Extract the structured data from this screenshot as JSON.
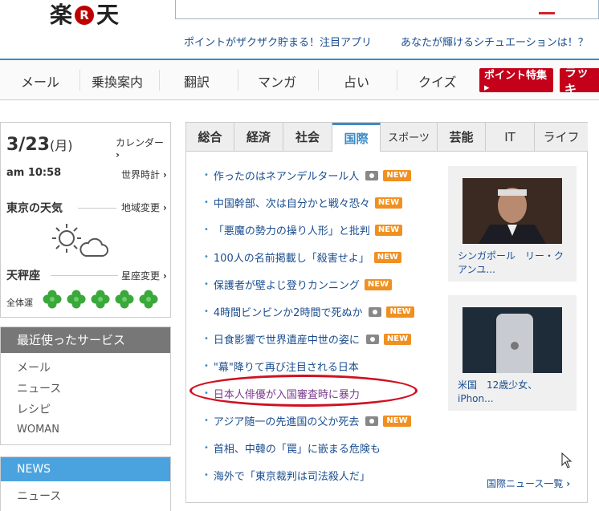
{
  "header": {
    "logo_left": "楽",
    "logo_r": "R",
    "logo_right": "天",
    "promo_1": "ポイントがザクザク貯まる！注目アプリ",
    "promo_2": "あなたが輝けるシチュエーションは！？"
  },
  "nav": {
    "items": [
      "メール",
      "乗換案内",
      "翻訳",
      "マンガ",
      "占い",
      "クイズ"
    ],
    "button_1": "ポイント特集 ▸",
    "button_2": "ラッキ"
  },
  "datebox": {
    "date": "3/23",
    "weekday": "(月)",
    "calendar": "カレンダー",
    "time": "am 10:58",
    "world_clock": "世界時計",
    "weather_title": "東京の天気",
    "region_change": "地域変更",
    "horoscope_title": "天秤座",
    "sign_change": "星座変更",
    "fortune_label": "全体運",
    "fortune_level": 5
  },
  "services": {
    "title": "最近使ったサービス",
    "items": [
      "メール",
      "ニュース",
      "レシピ",
      "WOMAN"
    ]
  },
  "news_sidebar": {
    "title": "NEWS",
    "item": "ニュース"
  },
  "main": {
    "tabs": [
      "総合",
      "経済",
      "社会",
      "国際",
      "スポーツ",
      "芸能",
      "IT",
      "ライフ"
    ],
    "active_tab": "国際",
    "headlines": [
      {
        "text": "作ったのはネアンデルタール人",
        "camera": true,
        "new": true
      },
      {
        "text": "中国幹部、次は自分かと戦々恐々",
        "camera": false,
        "new": true
      },
      {
        "text": "「悪魔の勢力の操り人形」と批判",
        "camera": false,
        "new": true
      },
      {
        "text": "100人の名前掲載し「殺害せよ」",
        "camera": false,
        "new": true
      },
      {
        "text": "保護者が壁よじ登りカンニング",
        "camera": false,
        "new": true
      },
      {
        "text": "4時間ビンビンか2時間で死ぬか",
        "camera": true,
        "new": true
      },
      {
        "text": "日食影響で世界遺産中世の姿に",
        "camera": true,
        "new": true
      },
      {
        "text": "\"幕\"降りて再び注目される日本",
        "camera": false,
        "new": false
      },
      {
        "text": "日本人俳優が入国審査時に暴力",
        "camera": false,
        "new": false
      },
      {
        "text": "アジア随一の先進国の父か死去",
        "camera": true,
        "new": true
      },
      {
        "text": "首相、中韓の「罠」に嵌まる危険も",
        "camera": false,
        "new": false
      },
      {
        "text": "海外で「東京裁判は司法殺人だ」",
        "camera": false,
        "new": false
      }
    ],
    "new_badge": "NEW",
    "card_1": "シンガポール　リー・クアンユ...",
    "card_2": "米国　12歳少女、iPhon...",
    "more": "国際ニュース一覧"
  },
  "colors": {
    "brand_red": "#bf0000",
    "accent_blue": "#3a8bc8",
    "new_orange": "#f09020",
    "annotation_red": "#d01020"
  }
}
